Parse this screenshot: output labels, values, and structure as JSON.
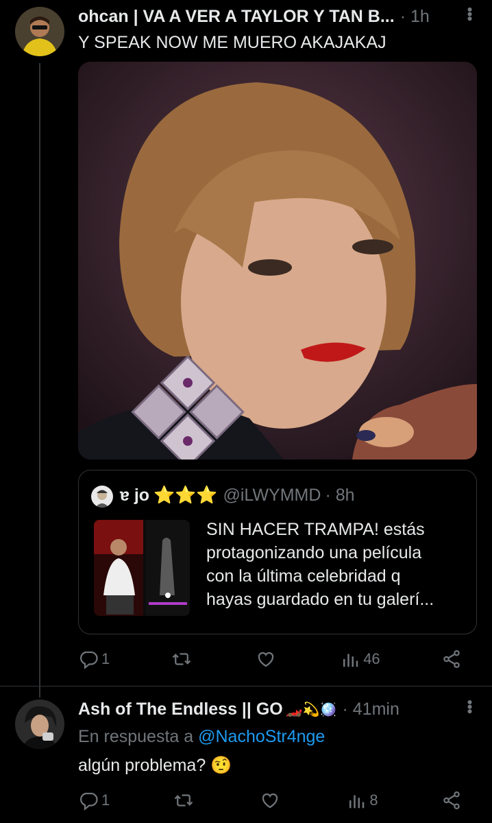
{
  "tweet1": {
    "name": "ohcan | VA A VER A TAYLOR Y TAN B...",
    "time": "· 1h",
    "text": "Y SPEAK NOW ME MUERO AKAJAKAJ",
    "quote": {
      "name": "ɐ jo",
      "stars": "⭐⭐⭐",
      "handle": "@iLWYMMD",
      "time": "· 8h",
      "lines": [
        "SIN HACER TRAMPA! estás",
        "protagonizando una película",
        "con la última celebridad q",
        "hayas guardado en tu galerí..."
      ]
    },
    "actions": {
      "replies": "1",
      "retweets": "",
      "likes": "",
      "views": "46"
    }
  },
  "tweet2": {
    "name": "Ash of The Endless || GO",
    "emojis": "🏎️💫🪩",
    "time": "· 41min",
    "reply_prefix": "En respuesta a",
    "reply_handle": "@NachoStr4nge",
    "text": "algún problema? 🤨",
    "actions": {
      "replies": "1",
      "retweets": "",
      "likes": "",
      "views": "8"
    }
  },
  "colors": {
    "background": "#000000",
    "muted": "#71767b",
    "link": "#1d9bf0",
    "text": "#e7e9ea"
  }
}
